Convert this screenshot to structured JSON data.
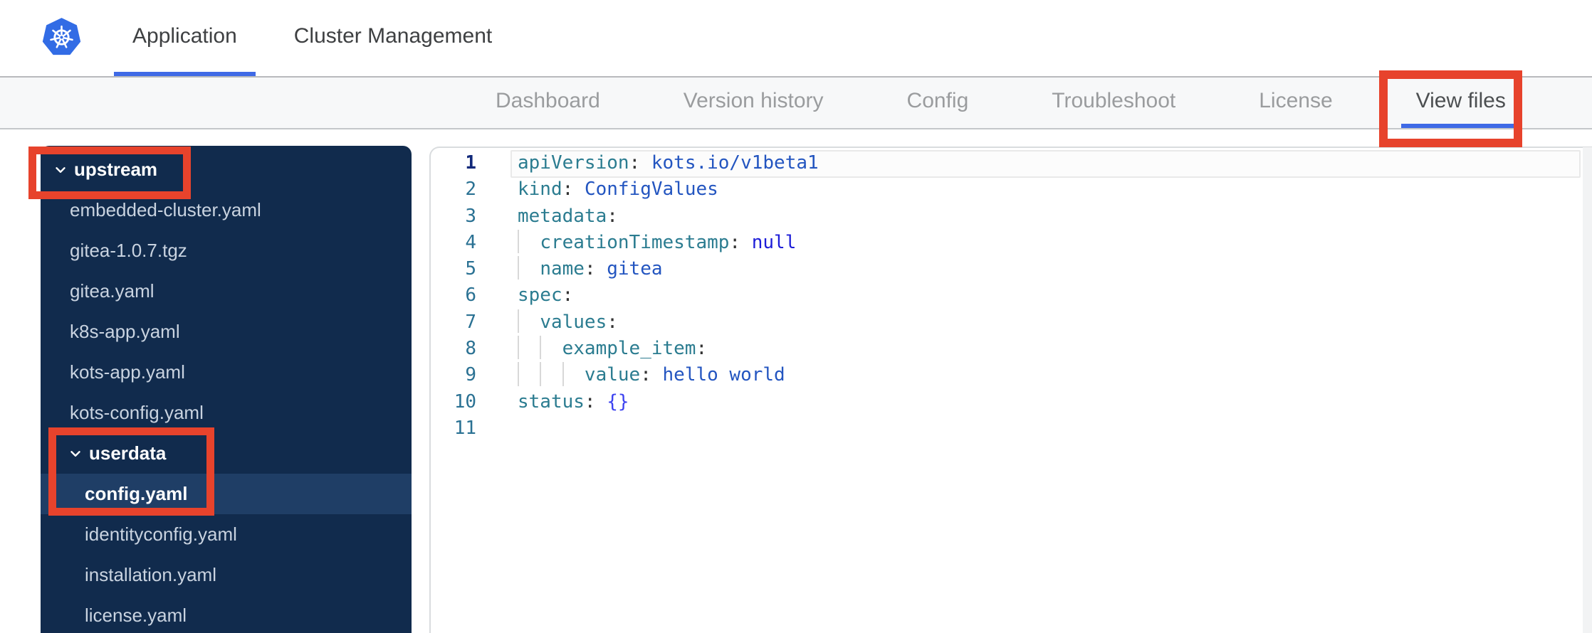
{
  "header": {
    "tabs": [
      {
        "label": "Application",
        "active": true
      },
      {
        "label": "Cluster Management",
        "active": false
      }
    ]
  },
  "nav": {
    "items": [
      {
        "label": "Dashboard",
        "active": false
      },
      {
        "label": "Version history",
        "active": false
      },
      {
        "label": "Config",
        "active": false
      },
      {
        "label": "Troubleshoot",
        "active": false
      },
      {
        "label": "License",
        "active": false
      },
      {
        "label": "View files",
        "active": true
      }
    ]
  },
  "file_tree": {
    "items": [
      {
        "label": "upstream",
        "type": "folder",
        "depth": 0,
        "expanded": true,
        "selected": false
      },
      {
        "label": "embedded-cluster.yaml",
        "type": "file",
        "depth": 1,
        "selected": false
      },
      {
        "label": "gitea-1.0.7.tgz",
        "type": "file",
        "depth": 1,
        "selected": false
      },
      {
        "label": "gitea.yaml",
        "type": "file",
        "depth": 1,
        "selected": false
      },
      {
        "label": "k8s-app.yaml",
        "type": "file",
        "depth": 1,
        "selected": false
      },
      {
        "label": "kots-app.yaml",
        "type": "file",
        "depth": 1,
        "selected": false
      },
      {
        "label": "kots-config.yaml",
        "type": "file",
        "depth": 1,
        "selected": false
      },
      {
        "label": "userdata",
        "type": "folder",
        "depth": 1,
        "expanded": true,
        "selected": false
      },
      {
        "label": "config.yaml",
        "type": "file",
        "depth": 2,
        "selected": true
      },
      {
        "label": "identityconfig.yaml",
        "type": "file",
        "depth": 2,
        "selected": false
      },
      {
        "label": "installation.yaml",
        "type": "file",
        "depth": 2,
        "selected": false
      },
      {
        "label": "license.yaml",
        "type": "file",
        "depth": 2,
        "selected": false
      }
    ]
  },
  "editor": {
    "file_content_plain": "apiVersion: kots.io/v1beta1\nkind: ConfigValues\nmetadata:\n  creationTimestamp: null\n  name: gitea\nspec:\n  values:\n    example_item:\n      value: hello world\nstatus: {}\n",
    "lines": [
      {
        "num": 1,
        "active": true,
        "indent": 0,
        "tokens": [
          [
            "key",
            "apiVersion"
          ],
          [
            "punc",
            ": "
          ],
          [
            "str",
            "kots.io/v1beta1"
          ]
        ]
      },
      {
        "num": 2,
        "active": false,
        "indent": 0,
        "tokens": [
          [
            "key",
            "kind"
          ],
          [
            "punc",
            ": "
          ],
          [
            "str",
            "ConfigValues"
          ]
        ]
      },
      {
        "num": 3,
        "active": false,
        "indent": 0,
        "tokens": [
          [
            "key",
            "metadata"
          ],
          [
            "punc",
            ":"
          ]
        ]
      },
      {
        "num": 4,
        "active": false,
        "indent": 2,
        "tokens": [
          [
            "key",
            "creationTimestamp"
          ],
          [
            "punc",
            ": "
          ],
          [
            "kw",
            "null"
          ]
        ]
      },
      {
        "num": 5,
        "active": false,
        "indent": 2,
        "tokens": [
          [
            "key",
            "name"
          ],
          [
            "punc",
            ": "
          ],
          [
            "str",
            "gitea"
          ]
        ]
      },
      {
        "num": 6,
        "active": false,
        "indent": 0,
        "tokens": [
          [
            "key",
            "spec"
          ],
          [
            "punc",
            ":"
          ]
        ]
      },
      {
        "num": 7,
        "active": false,
        "indent": 2,
        "tokens": [
          [
            "key",
            "values"
          ],
          [
            "punc",
            ":"
          ]
        ]
      },
      {
        "num": 8,
        "active": false,
        "indent": 4,
        "tokens": [
          [
            "key",
            "example_item"
          ],
          [
            "punc",
            ":"
          ]
        ]
      },
      {
        "num": 9,
        "active": false,
        "indent": 6,
        "tokens": [
          [
            "key",
            "value"
          ],
          [
            "punc",
            ": "
          ],
          [
            "str",
            "hello world"
          ]
        ]
      },
      {
        "num": 10,
        "active": false,
        "indent": 0,
        "tokens": [
          [
            "key",
            "status"
          ],
          [
            "punc",
            ": "
          ],
          [
            "br",
            "{}"
          ]
        ]
      },
      {
        "num": 11,
        "active": false,
        "indent": 0,
        "tokens": []
      }
    ]
  },
  "annotations": {
    "color": "#e7432c",
    "boxes": [
      "view-files-tab",
      "upstream-folder",
      "userdata-and-config-yaml"
    ]
  },
  "colors": {
    "accent_blue": "#3f6ae6",
    "kubernetes_blue": "#326ce5",
    "sidebar_bg": "#112b4d",
    "sidebar_selected_bg": "#1f3e66",
    "navbar_bg": "#f7f8f9",
    "annotation_red": "#e7432c",
    "code_key": "#2b7c90",
    "code_string": "#2355c0",
    "code_keyword": "#1d1dd8",
    "line_number": "#2a7193"
  }
}
